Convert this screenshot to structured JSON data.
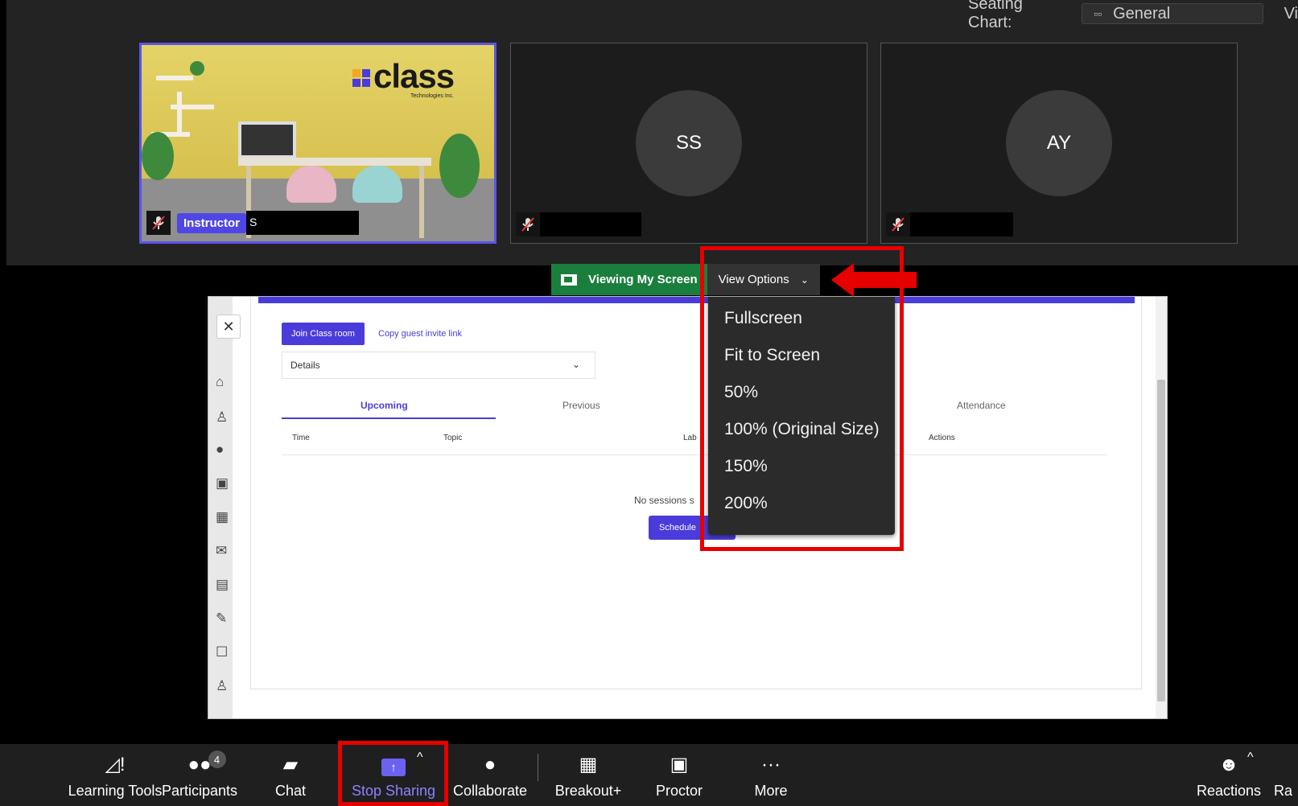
{
  "seating": {
    "label": "Seating Chart:",
    "value": "General",
    "cut_label": "Vi"
  },
  "tiles": [
    {
      "role_badge": "Instructor",
      "name_partial": "S"
    },
    {
      "initials": "SS"
    },
    {
      "initials": "AY"
    }
  ],
  "logo": {
    "word": "class",
    "sub": "Technologies Inc.",
    "squares": [
      "#f5a623",
      "#4a3cdb",
      "#4a3cdb",
      "#4a3cdb"
    ]
  },
  "share_bar": {
    "viewing_label": "Viewing My Screen",
    "view_options_label": "View Options"
  },
  "view_menu": {
    "items": [
      "Fullscreen",
      "Fit to Screen",
      "50%",
      "100% (Original Size)",
      "150%",
      "200%"
    ]
  },
  "shared_screen": {
    "join_label": "Join Class room",
    "copy_label": "Copy guest invite link",
    "details_value": "Details",
    "tabs": [
      "Upcoming",
      "Previous",
      "Attendance"
    ],
    "columns": [
      "Time",
      "Topic",
      "Lab",
      "Actions"
    ],
    "empty_text": "No sessions s",
    "schedule_label": "Schedule"
  },
  "toolbar": {
    "learning_tools": "Learning Tools",
    "participants": "Participants",
    "participants_count": "4",
    "chat": "Chat",
    "stop_sharing": "Stop Sharing",
    "collaborate": "Collaborate",
    "breakout": "Breakout+",
    "proctor": "Proctor",
    "more": "More",
    "reactions": "Reactions",
    "cut_label": "Ra"
  },
  "colors": {
    "accent": "#4a3cdb",
    "highlight": "#e60000",
    "viewing_green": "#1a7f3c",
    "stop_sharing_text": "#8b83ff"
  }
}
